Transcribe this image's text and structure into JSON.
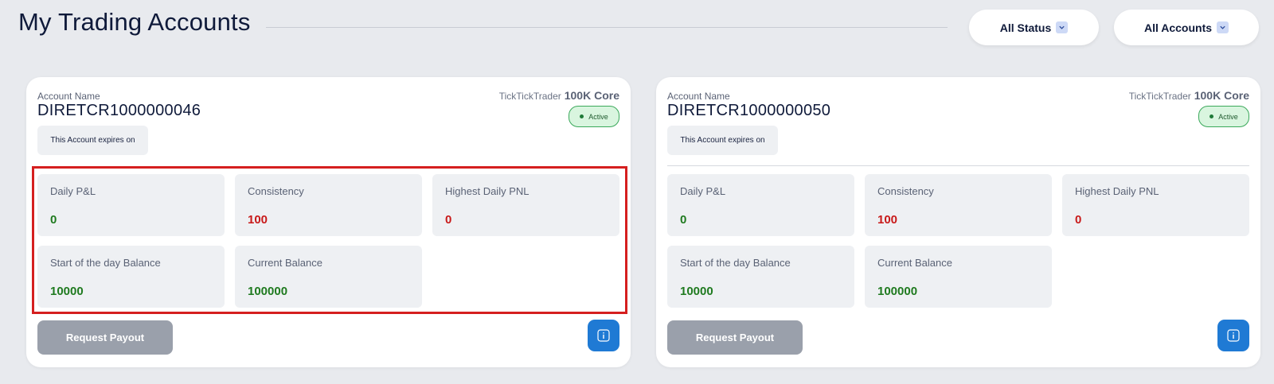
{
  "header": {
    "title": "My Trading Accounts",
    "filters": {
      "status_label": "All Status",
      "accounts_label": "All Accounts"
    }
  },
  "colors": {
    "positive": "#1f7a1f",
    "negative": "#c81a1a",
    "info_button": "#1f7ad4",
    "highlight": "#d51f1f"
  },
  "icons": {
    "filter": "chevron-down-icon",
    "status": "status-dot-icon",
    "info": "info-icon"
  },
  "accounts": [
    {
      "name_label": "Account Name",
      "name": "DIRETCR1000000046",
      "platform": "TickTickTrader",
      "plan": "100K Core",
      "status": "Active",
      "expiry_text": "This Account expires on",
      "metrics": [
        {
          "label": "Daily P&L",
          "value": "0"
        },
        {
          "label": "Consistency",
          "value": "100"
        },
        {
          "label": "Highest Daily PNL",
          "value": "0"
        },
        {
          "label": "Start of the day Balance",
          "value": "10000"
        },
        {
          "label": "Current Balance",
          "value": "100000"
        }
      ],
      "payout_label": "Request Payout"
    },
    {
      "name_label": "Account Name",
      "name": "DIRETCR1000000050",
      "platform": "TickTickTrader",
      "plan": "100K Core",
      "status": "Active",
      "expiry_text": "This Account expires on",
      "metrics": [
        {
          "label": "Daily P&L",
          "value": "0"
        },
        {
          "label": "Consistency",
          "value": "100"
        },
        {
          "label": "Highest Daily PNL",
          "value": "0"
        },
        {
          "label": "Start of the day Balance",
          "value": "10000"
        },
        {
          "label": "Current Balance",
          "value": "100000"
        }
      ],
      "payout_label": "Request Payout"
    }
  ]
}
